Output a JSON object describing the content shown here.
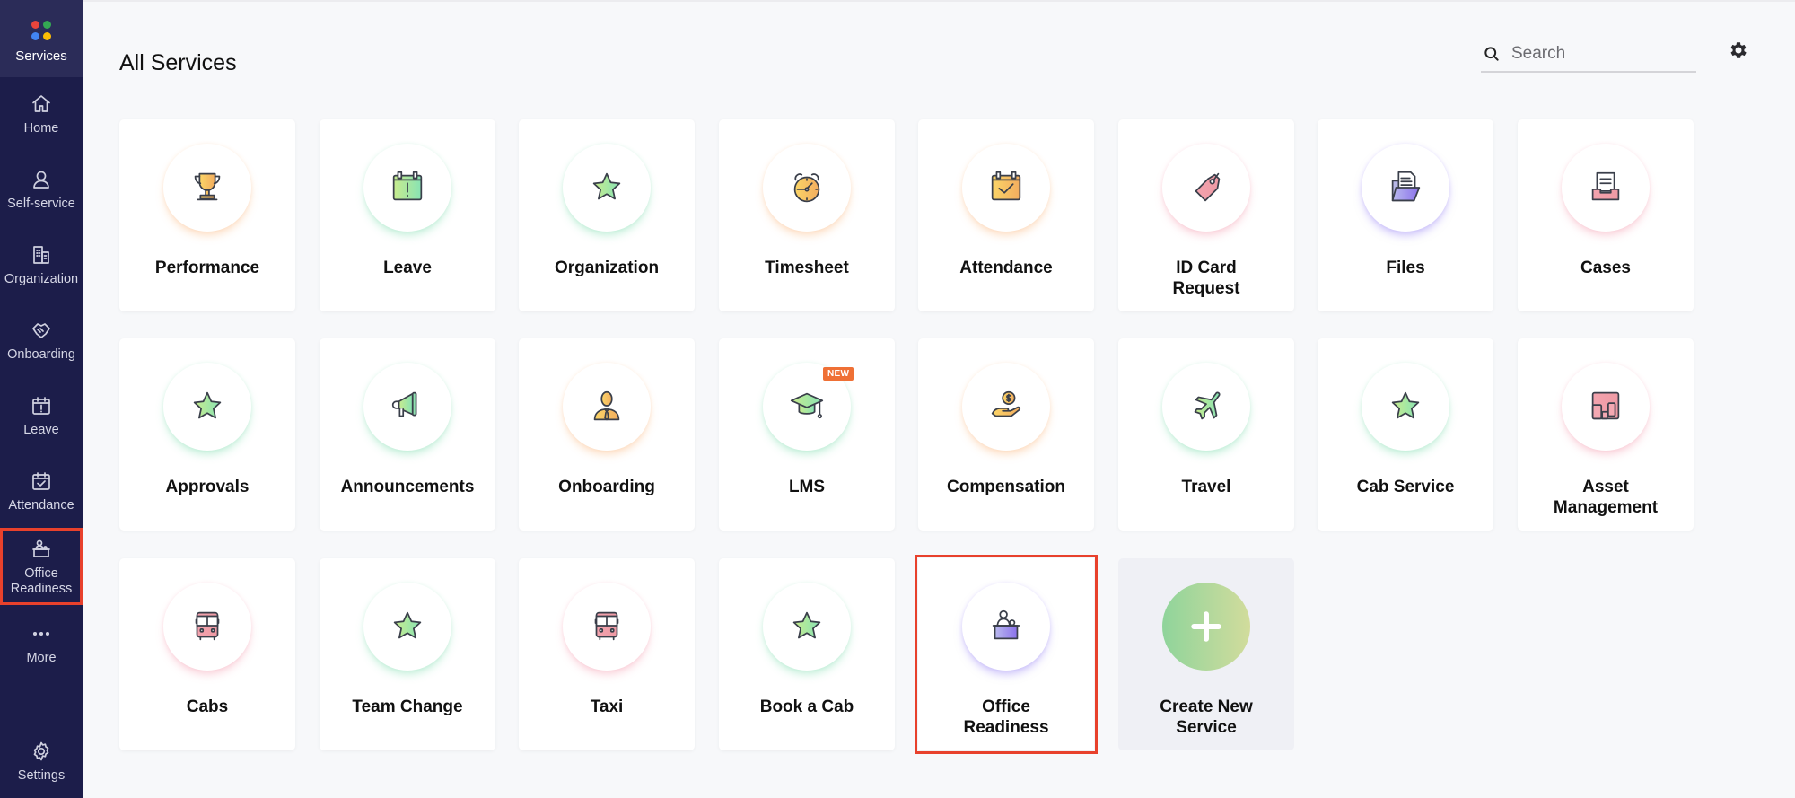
{
  "sidebar": {
    "items": [
      {
        "id": "services",
        "label": "Services",
        "icon": "services-dots-icon",
        "active": true
      },
      {
        "id": "home",
        "label": "Home",
        "icon": "home-icon"
      },
      {
        "id": "self-service",
        "label": "Self-service",
        "icon": "user-icon"
      },
      {
        "id": "organization",
        "label": "Organization",
        "icon": "building-icon"
      },
      {
        "id": "onboarding",
        "label": "Onboarding",
        "icon": "handshake-icon"
      },
      {
        "id": "leave",
        "label": "Leave",
        "icon": "calendar-alert-icon"
      },
      {
        "id": "attendance",
        "label": "Attendance",
        "icon": "calendar-check-icon"
      },
      {
        "id": "office-readiness",
        "label": "Office\nReadiness",
        "icon": "reception-desk-icon",
        "highlighted": true
      },
      {
        "id": "more",
        "label": "More",
        "icon": "more-dots-icon"
      },
      {
        "id": "settings",
        "label": "Settings",
        "icon": "gear-icon"
      }
    ],
    "services_dot_colors": [
      "#e8453c",
      "#34a853",
      "#4285f4",
      "#fbbc05"
    ]
  },
  "header": {
    "title": "All Services",
    "search": {
      "placeholder": "Search",
      "value": ""
    },
    "settings_icon": "gear-icon"
  },
  "services": [
    {
      "label": "Performance",
      "icon": "trophy-icon",
      "glow": "orange"
    },
    {
      "label": "Leave",
      "icon": "calendar-alert-icon",
      "glow": "green"
    },
    {
      "label": "Organization",
      "icon": "star-icon",
      "glow": "green"
    },
    {
      "label": "Timesheet",
      "icon": "alarm-clock-icon",
      "glow": "orange"
    },
    {
      "label": "Attendance",
      "icon": "calendar-check-icon",
      "glow": "orange"
    },
    {
      "label": "ID Card\nRequest",
      "icon": "tag-icon",
      "glow": "pink"
    },
    {
      "label": "Files",
      "icon": "folder-document-icon",
      "glow": "purple"
    },
    {
      "label": "Cases",
      "icon": "inbox-tray-icon",
      "glow": "pink"
    },
    {
      "label": "Approvals",
      "icon": "star-icon",
      "glow": "green"
    },
    {
      "label": "Announcements",
      "icon": "megaphone-icon",
      "glow": "green"
    },
    {
      "label": "Onboarding",
      "icon": "employee-icon",
      "glow": "orange"
    },
    {
      "label": "LMS",
      "icon": "graduation-cap-icon",
      "glow": "green",
      "badge": "NEW"
    },
    {
      "label": "Compensation",
      "icon": "hand-coin-icon",
      "glow": "orange"
    },
    {
      "label": "Travel",
      "icon": "airplane-icon",
      "glow": "green"
    },
    {
      "label": "Cab Service",
      "icon": "star-icon",
      "glow": "green"
    },
    {
      "label": "Asset\nManagement",
      "icon": "devices-icon",
      "glow": "pink"
    },
    {
      "label": "Cabs",
      "icon": "bus-icon",
      "glow": "pink"
    },
    {
      "label": "Team Change",
      "icon": "star-icon",
      "glow": "green"
    },
    {
      "label": "Taxi",
      "icon": "bus-icon",
      "glow": "pink"
    },
    {
      "label": "Book a Cab",
      "icon": "star-icon",
      "glow": "green"
    },
    {
      "label": "Office\nReadiness",
      "icon": "reception-desk-icon",
      "glow": "purple",
      "highlighted": true
    },
    {
      "label": "Create New\nService",
      "icon": "plus-icon",
      "create": true
    }
  ],
  "colors": {
    "sidebar_bg": "#1c1d4a",
    "highlight": "#e8412c",
    "badge": "#ef7035"
  }
}
